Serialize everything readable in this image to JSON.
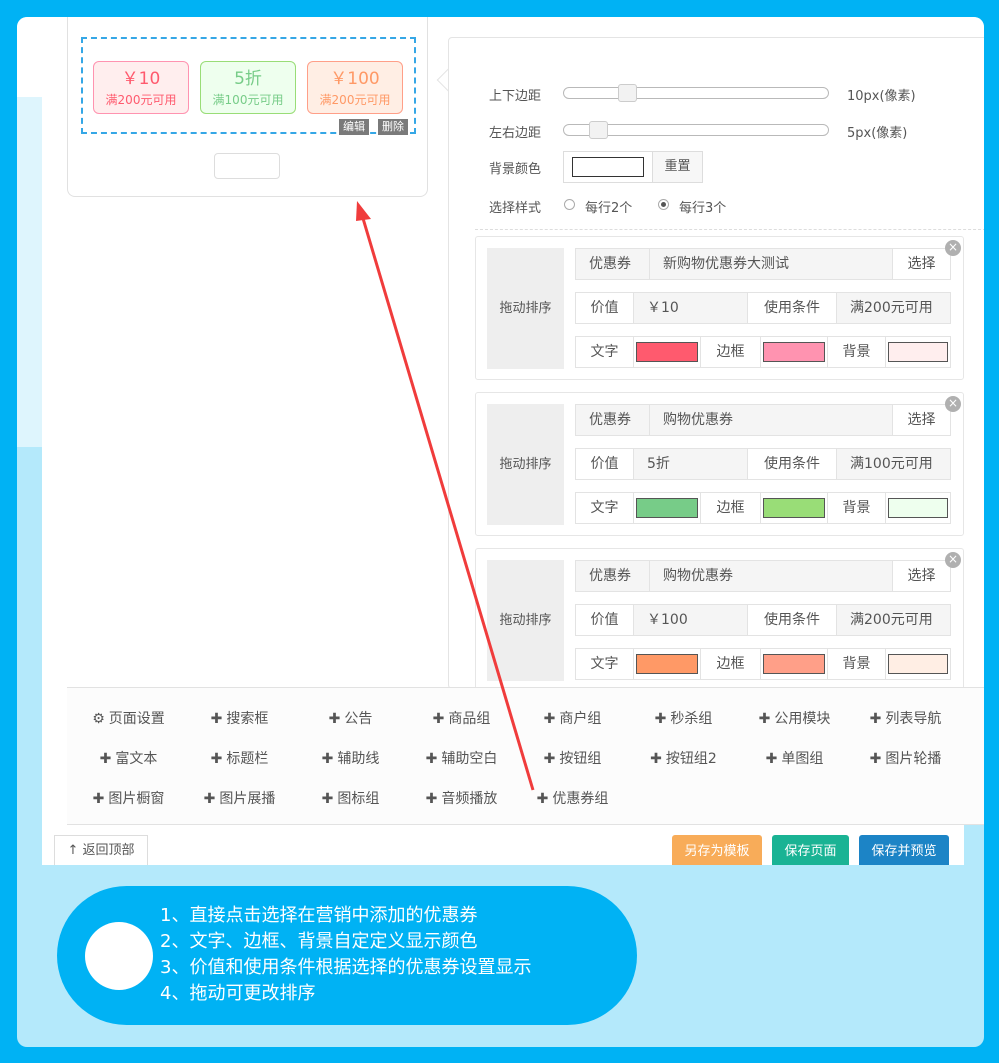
{
  "preview": {
    "coupons": [
      {
        "value": "￥10",
        "condition": "满200元可用"
      },
      {
        "value": "5折",
        "condition": "满100元可用"
      },
      {
        "value": "￥100",
        "condition": "满200元可用"
      }
    ],
    "edit_label": "编辑",
    "delete_label": "删除"
  },
  "settings": {
    "margin_v_label": "上下边距",
    "margin_v_value": "10px(像素)",
    "margin_v_level": 0.22,
    "margin_h_label": "左右边距",
    "margin_h_value": "5px(像素)",
    "margin_h_level": 0.1,
    "bg_color_label": "背景颜色",
    "reset_label": "重置",
    "style_label": "选择样式",
    "style_opt1": "每行2个",
    "style_opt2": "每行3个",
    "style_selected": "每行3个"
  },
  "card_labels": {
    "drag": "拖动排序",
    "coupon": "优惠券",
    "select": "选择",
    "value": "价值",
    "condition": "使用条件",
    "text": "文字",
    "border": "边框",
    "background": "背景",
    "close": "×"
  },
  "cards": [
    {
      "name": "新购物优惠券大测试",
      "value": "￥10",
      "condition": "满200元可用",
      "text_color": "#ff5a6e",
      "border_color": "#ff93b0",
      "bg_color": "#ffeeee"
    },
    {
      "name": "购物优惠券",
      "value": "5折",
      "condition": "满100元可用",
      "text_color": "#77cc88",
      "border_color": "#99dd77",
      "bg_color": "#eeffee"
    },
    {
      "name": "购物优惠券",
      "value": "￥100",
      "condition": "满200元可用",
      "text_color": "#ff9966",
      "border_color": "#ff9f88",
      "bg_color": "#ffeee4"
    }
  ],
  "modules": {
    "row1": [
      {
        "icon": "gear-icon",
        "label": "页面设置"
      },
      {
        "icon": "plus-icon",
        "label": "搜索框"
      },
      {
        "icon": "plus-icon",
        "label": "公告"
      },
      {
        "icon": "plus-icon",
        "label": "商品组"
      },
      {
        "icon": "plus-icon",
        "label": "商户组"
      },
      {
        "icon": "plus-icon",
        "label": "秒杀组"
      },
      {
        "icon": "plus-icon",
        "label": "公用模块"
      },
      {
        "icon": "plus-icon",
        "label": "列表导航"
      }
    ],
    "row2": [
      {
        "icon": "plus-icon",
        "label": "富文本"
      },
      {
        "icon": "plus-icon",
        "label": "标题栏"
      },
      {
        "icon": "plus-icon",
        "label": "辅助线"
      },
      {
        "icon": "plus-icon",
        "label": "辅助空白"
      },
      {
        "icon": "plus-icon",
        "label": "按钮组"
      },
      {
        "icon": "plus-icon",
        "label": "按钮组2"
      },
      {
        "icon": "plus-icon",
        "label": "单图组"
      },
      {
        "icon": "plus-icon",
        "label": "图片轮播"
      }
    ],
    "row3": [
      {
        "icon": "plus-icon",
        "label": "图片橱窗"
      },
      {
        "icon": "plus-icon",
        "label": "图片展播"
      },
      {
        "icon": "plus-icon",
        "label": "图标组"
      },
      {
        "icon": "plus-icon",
        "label": "音频播放"
      },
      {
        "icon": "plus-icon",
        "label": "优惠券组"
      }
    ]
  },
  "footer": {
    "back_top_icon": "arrow-up-icon",
    "back_top": "返回顶部",
    "save_template": "另存为模板",
    "save_page": "保存页面",
    "save_preview": "保存并预览"
  },
  "callout": {
    "lines": [
      "1、直接点击选择在营销中添加的优惠券",
      "2、文字、边框、背景自定定义显示颜色",
      "3、价值和使用条件根据选择的优惠券设置显示",
      "4、拖动可更改排序"
    ]
  },
  "colors": {
    "frame": "#00b2f4",
    "coupon1_text": "#ff5a6e",
    "coupon2_text": "#77cc88",
    "coupon3_text": "#ff9966",
    "btn_template": "#f8ac59",
    "btn_save": "#1ab394",
    "btn_preview": "#1c84c6",
    "arrow": "#f03c3c"
  }
}
